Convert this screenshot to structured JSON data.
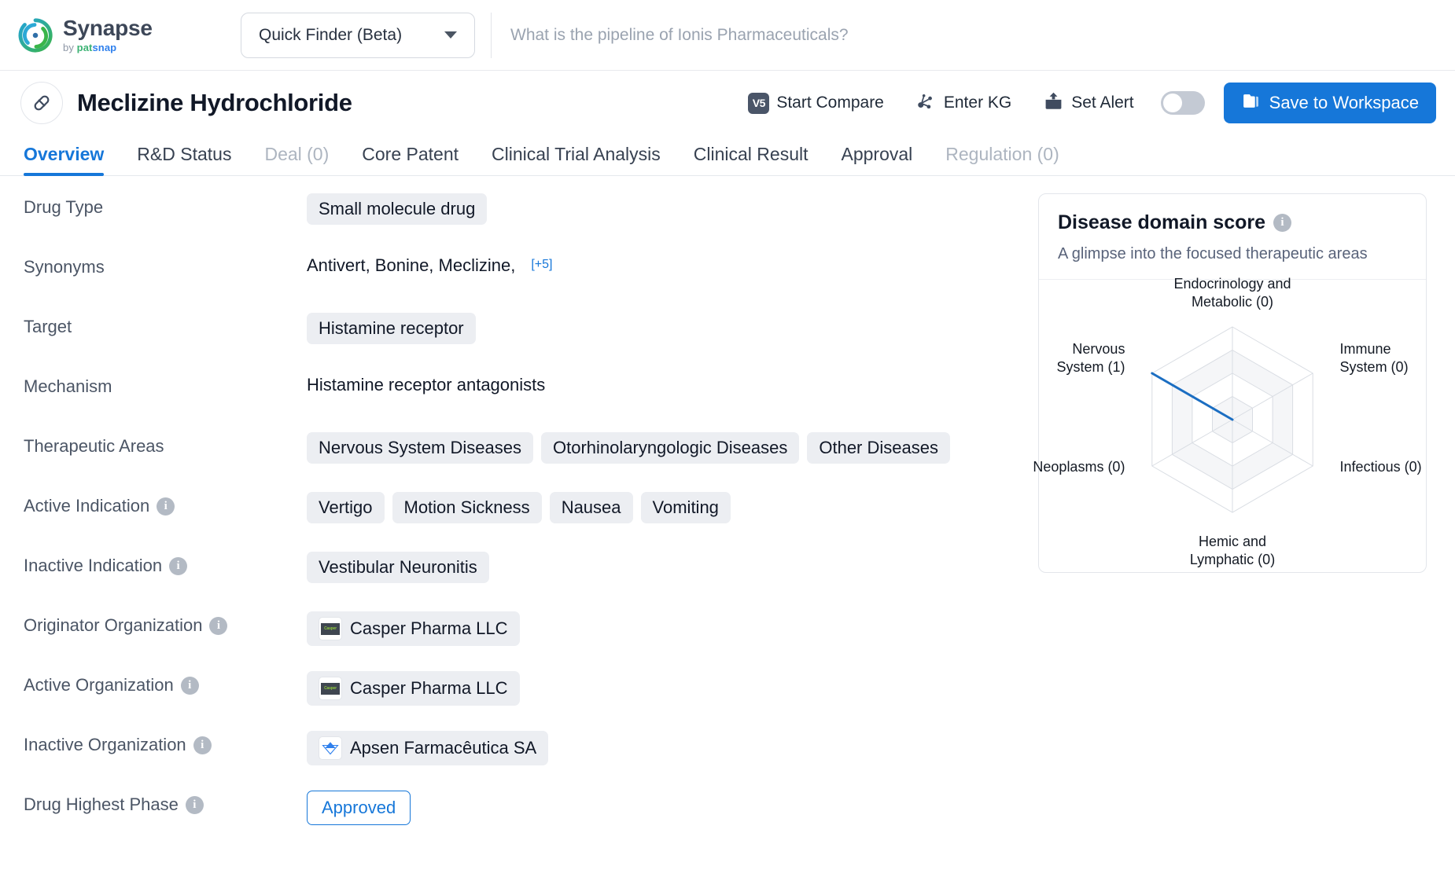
{
  "brand": {
    "name": "Synapse",
    "by": "by ",
    "pat": "pat",
    "snap": "snap",
    "logo_icon": "synapse-logo-icon"
  },
  "search": {
    "finder_label": "Quick Finder (Beta)",
    "placeholder": "What is the pipeline of Ionis Pharmaceuticals?",
    "value": ""
  },
  "header": {
    "drug_icon": "capsule-icon",
    "title": "Meclizine Hydrochloride",
    "actions": [
      {
        "label": "Start Compare",
        "icon": "v5-compare-icon",
        "badge": "V5"
      },
      {
        "label": "Enter KG",
        "icon": "knowledge-graph-icon"
      },
      {
        "label": "Set Alert",
        "icon": "alert-bell-icon"
      }
    ],
    "alert_toggle_on": false,
    "save_label": "Save to Workspace",
    "save_icon": "folder-icon",
    "accent_color": "#1677d9"
  },
  "tabs": [
    {
      "label": "Overview",
      "state": "active"
    },
    {
      "label": "R&D Status",
      "state": "normal"
    },
    {
      "label": "Deal (0)",
      "state": "muted"
    },
    {
      "label": "Core Patent",
      "state": "normal"
    },
    {
      "label": "Clinical Trial Analysis",
      "state": "normal"
    },
    {
      "label": "Clinical Result",
      "state": "normal"
    },
    {
      "label": "Approval",
      "state": "normal"
    },
    {
      "label": "Regulation (0)",
      "state": "muted"
    }
  ],
  "fields": {
    "drug_type": {
      "label": "Drug Type",
      "values": [
        "Small molecule drug"
      ]
    },
    "synonyms": {
      "label": "Synonyms",
      "text": "Antivert,  Bonine,  Meclizine,",
      "more": "[+5]"
    },
    "target": {
      "label": "Target",
      "values": [
        "Histamine receptor"
      ]
    },
    "mechanism": {
      "label": "Mechanism",
      "text": "Histamine receptor antagonists"
    },
    "therapeutic_areas": {
      "label": "Therapeutic Areas",
      "values": [
        "Nervous System Diseases",
        "Otorhinolaryngologic Diseases",
        "Other Diseases"
      ]
    },
    "active_indication": {
      "label": "Active Indication",
      "values": [
        "Vertigo",
        "Motion Sickness",
        "Nausea",
        "Vomiting"
      ]
    },
    "inactive_indication": {
      "label": "Inactive Indication",
      "values": [
        "Vestibular Neuronitis"
      ]
    },
    "originator_organization": {
      "label": "Originator Organization",
      "org": "Casper Pharma LLC",
      "logo_text": "Casper"
    },
    "active_organization": {
      "label": "Active Organization",
      "org": "Casper Pharma LLC",
      "logo_text": "Casper"
    },
    "inactive_organization": {
      "label": "Inactive Organization",
      "org": "Apsen Farmacêutica SA",
      "logo_icon": "apsen-mountain-icon"
    },
    "drug_highest_phase": {
      "label": "Drug Highest Phase",
      "value": "Approved"
    }
  },
  "disease_panel": {
    "title": "Disease domain score",
    "info_icon": "info-icon",
    "subtitle": "A glimpse into the focused therapeutic areas"
  },
  "chart_data": {
    "type": "radar",
    "title": "Disease domain score",
    "subtitle": "A glimpse into the focused therapeutic areas",
    "categories": [
      "Endocrinology and Metabolic (0)",
      "Immune System (0)",
      "Infectious (0)",
      "Hemic and Lymphatic (0)",
      "Neoplasms (0)",
      "Nervous System (1)"
    ],
    "labels": [
      "Endocrinology and\nMetabolic (0)",
      "Immune\nSystem (0)",
      "Infectious (0)",
      "Hemic and\nLymphatic (0)",
      "Neoplasms (0)",
      "Nervous\nSystem (1)"
    ],
    "values": [
      0,
      0,
      0,
      0,
      0,
      1
    ],
    "rmax": 1,
    "rings": 4,
    "grid": true,
    "legend": false,
    "series_color": "#1b6ec2",
    "grid_color": "#d9dde3"
  }
}
